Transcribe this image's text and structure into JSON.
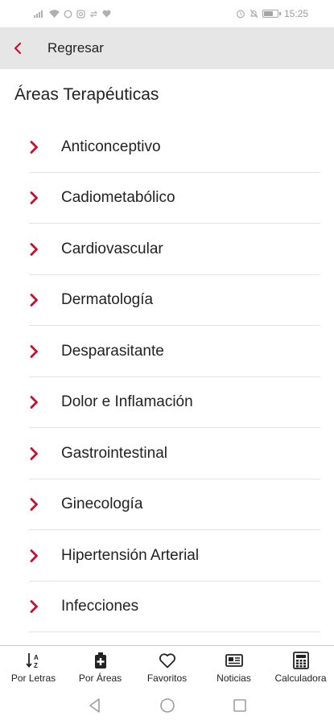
{
  "status_bar": {
    "time": "15:25",
    "left_icons": [
      "signal-icon",
      "wifi-icon",
      "whatsapp-icon",
      "instagram-icon",
      "sync-icon",
      "heart-icon"
    ],
    "right_icons": [
      "alarm-icon",
      "mute-icon",
      "battery-icon"
    ]
  },
  "header": {
    "back_label": "Regresar",
    "accent": "#c8102e",
    "background": "#e6e6e6"
  },
  "page": {
    "title": "Áreas Terapéuticas"
  },
  "list": {
    "items": [
      {
        "label": "Anticonceptivo"
      },
      {
        "label": "Cadiometabólico"
      },
      {
        "label": "Cardiovascular"
      },
      {
        "label": "Dermatología"
      },
      {
        "label": "Desparasitante"
      },
      {
        "label": "Dolor e Inflamación"
      },
      {
        "label": "Gastrointestinal"
      },
      {
        "label": "Ginecología"
      },
      {
        "label": "Hipertensión Arterial"
      },
      {
        "label": "Infecciones"
      }
    ]
  },
  "tabbar": {
    "tabs": [
      {
        "label": "Por Letras",
        "icon": "sort-az-icon"
      },
      {
        "label": "Por Áreas",
        "icon": "medicine-bag-icon"
      },
      {
        "label": "Favoritos",
        "icon": "heart-outline-icon"
      },
      {
        "label": "Noticias",
        "icon": "newspaper-icon"
      },
      {
        "label": "Calculadora",
        "icon": "calculator-icon"
      }
    ]
  },
  "navbar": {
    "buttons": [
      "back-triangle-icon",
      "home-circle-icon",
      "recents-square-icon"
    ]
  }
}
